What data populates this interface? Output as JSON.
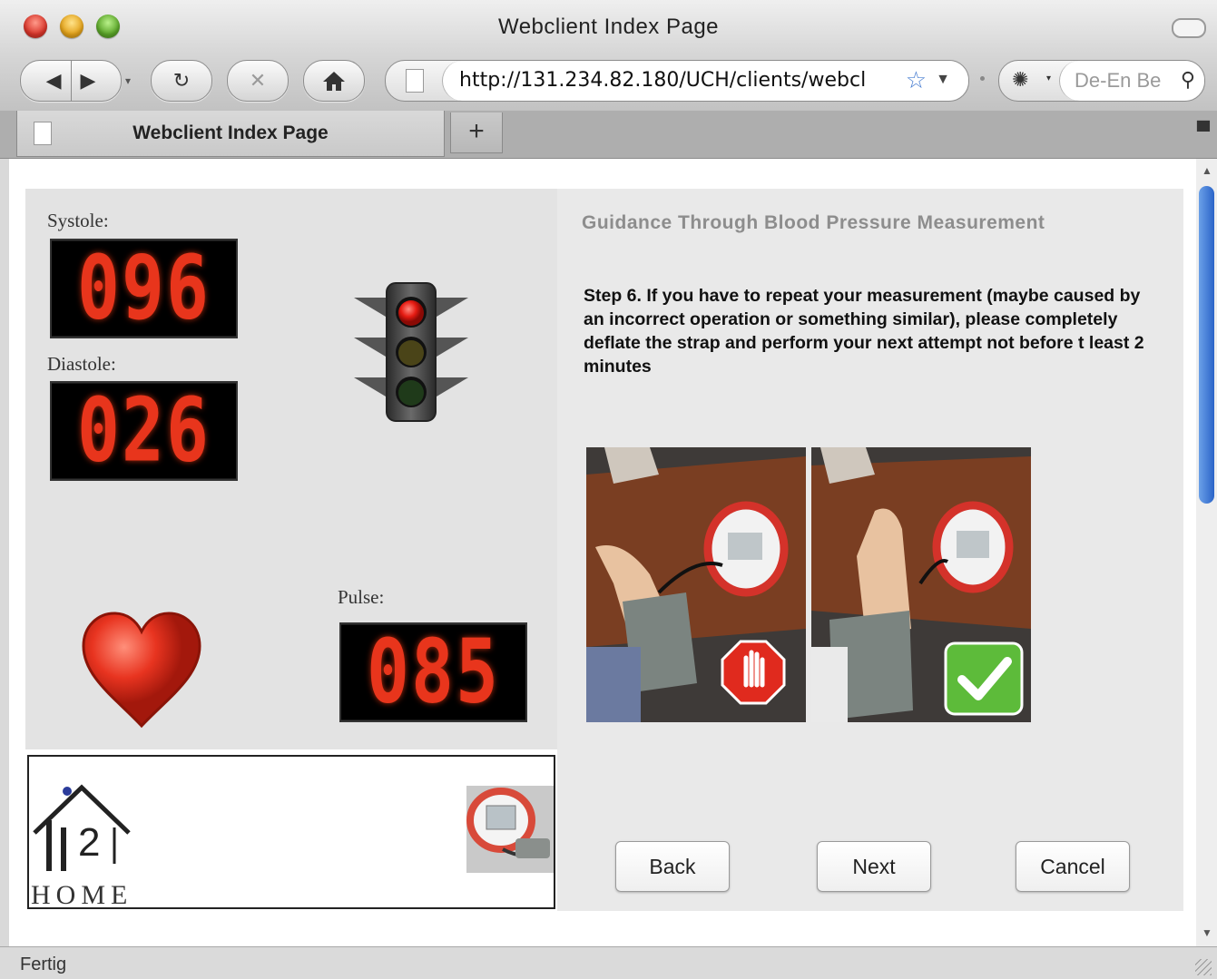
{
  "window": {
    "title": "Webclient Index Page"
  },
  "toolbar": {
    "url": "http://131.234.82.180/UCH/clients/webcl",
    "search_placeholder": "De-En Be"
  },
  "tabs": [
    {
      "label": "Webclient Index Page"
    }
  ],
  "vitals": {
    "systole_label": "Systole:",
    "systole_value": "096",
    "diastole_label": "Diastole:",
    "diastole_value": "026",
    "pulse_label": "Pulse:",
    "pulse_value": "085",
    "traffic_light_state": "red",
    "led_color": "#e8351c"
  },
  "brand": {
    "logo_text": "HOME",
    "logo_number": "2"
  },
  "guidance": {
    "title": "Guidance Through Blood Pressure Measurement",
    "step_text": "Step 6. If you have to repeat your measurement (maybe caused by an incorrect operation or something similar), please completely deflate the strap and perform your next attempt not before t least 2 minutes",
    "images": [
      {
        "badge": "stop-hand-icon"
      },
      {
        "badge": "checkmark-icon"
      }
    ]
  },
  "buttons": {
    "back": "Back",
    "next": "Next",
    "cancel": "Cancel"
  },
  "status": {
    "text": "Fertig"
  }
}
